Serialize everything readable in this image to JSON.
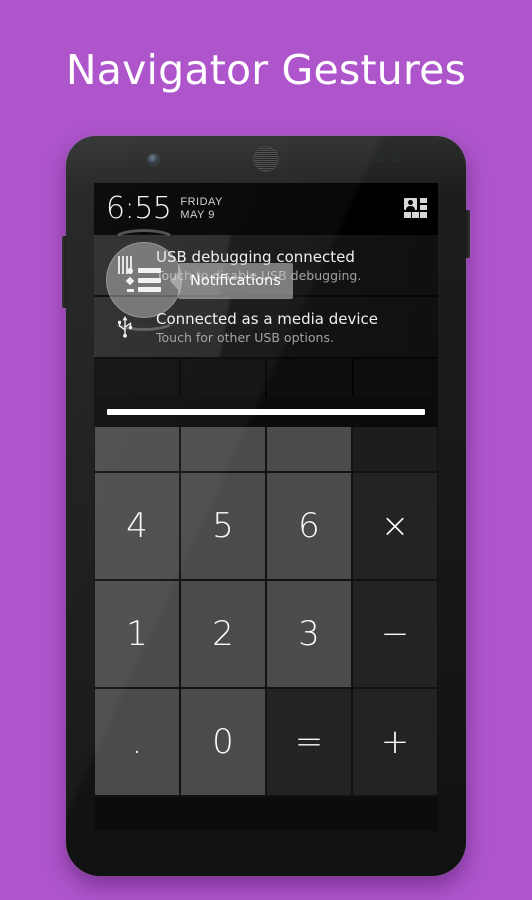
{
  "page": {
    "headline": "Navigator Gestures",
    "background_color": "#ae55cc"
  },
  "phone": {
    "hardware": {
      "front_camera": "front-camera",
      "earpiece": "earpiece-speaker",
      "sensors": [
        "proximity-sensor",
        "light-sensor"
      ],
      "volume_button": "volume-rocker",
      "power_button": "power-button"
    }
  },
  "status_bar": {
    "time": "6:55",
    "day": "FRIDAY",
    "date": "MAY 9",
    "quick_settings_icon": "user-grid-icon"
  },
  "notifications": [
    {
      "icon": "usb-debug-bars-icon",
      "title": "USB debugging connected",
      "subtitle": "Touch to disable USB debugging."
    },
    {
      "icon": "usb-icon",
      "title": "Connected as a media device",
      "subtitle": "Touch for other USB options."
    }
  ],
  "shade": {
    "tile_count": 4,
    "handle_label": "shade-handle"
  },
  "calculator": {
    "keys": [
      {
        "label": "",
        "type": "blank"
      },
      {
        "label": "",
        "type": "blank"
      },
      {
        "label": "",
        "type": "blank"
      },
      {
        "label": "",
        "type": "blank-op"
      },
      {
        "label": "4",
        "type": "num"
      },
      {
        "label": "5",
        "type": "num"
      },
      {
        "label": "6",
        "type": "num"
      },
      {
        "label": "×",
        "type": "op"
      },
      {
        "label": "1",
        "type": "num"
      },
      {
        "label": "2",
        "type": "num"
      },
      {
        "label": "3",
        "type": "num"
      },
      {
        "label": "−",
        "type": "op"
      },
      {
        "label": ".",
        "type": "num"
      },
      {
        "label": "0",
        "type": "num"
      },
      {
        "label": "=",
        "type": "op"
      },
      {
        "label": "+",
        "type": "op"
      }
    ]
  },
  "gesture_overlay": {
    "icon": "notifications-list-icon",
    "tooltip_label": "Notifications"
  }
}
